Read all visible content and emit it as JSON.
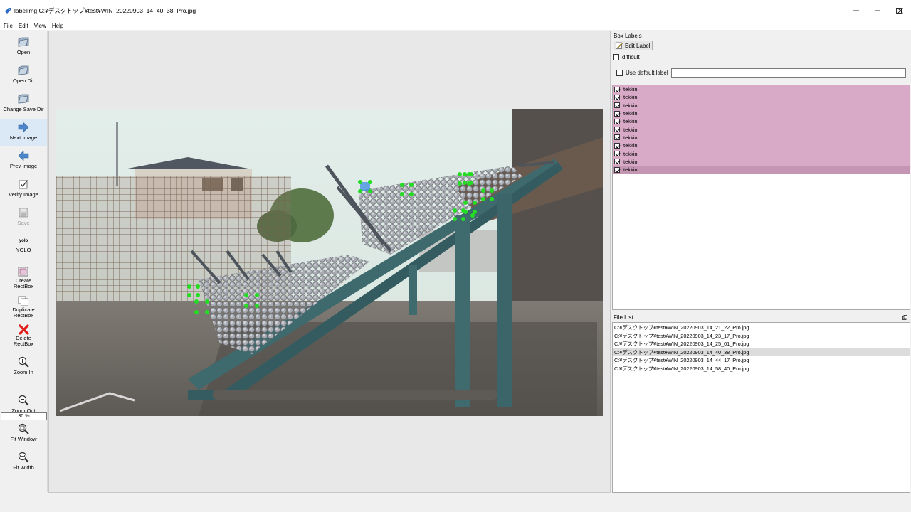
{
  "window": {
    "title": "labelImg C:¥デスクトップ¥test¥WIN_20220903_14_40_38_Pro.jpg"
  },
  "menu": [
    "File",
    "Edit",
    "View",
    "Help"
  ],
  "toolbar": {
    "open": "Open",
    "open_dir": "Open Dir",
    "change_save_dir": "Change Save Dir",
    "next_image": "Next Image",
    "prev_image": "Prev Image",
    "verify_image": "Verify Image",
    "save": "Save",
    "yolo_icon_text": "yolo",
    "yolo": "YOLO",
    "create_rectbox": "Create\nRectBox",
    "duplicate_rectbox": "Duplicate\nRectBox",
    "delete_rectbox": "Delete\nRectBox",
    "zoom_in": "Zoom In",
    "zoom_level": "30 %",
    "zoom_out": "Zoom Out",
    "fit_window": "Fit Window",
    "fit_width": "Fit Width"
  },
  "box_labels": {
    "title": "Box Labels",
    "edit_label": "Edit Label",
    "difficult": "difficult",
    "use_default_label": "Use default label",
    "default_label_value": "",
    "items": [
      {
        "label": "tekkin",
        "checked": true
      },
      {
        "label": "tekkin",
        "checked": true
      },
      {
        "label": "tekkin",
        "checked": true
      },
      {
        "label": "tekkin",
        "checked": true
      },
      {
        "label": "tekkin",
        "checked": true
      },
      {
        "label": "tekkin",
        "checked": true
      },
      {
        "label": "tekkin",
        "checked": true
      },
      {
        "label": "tekkin",
        "checked": true
      },
      {
        "label": "tekkin",
        "checked": true
      },
      {
        "label": "tekkin",
        "checked": true
      },
      {
        "label": "tekkin",
        "checked": true,
        "selected": true
      }
    ]
  },
  "file_list": {
    "title": "File List",
    "items": [
      {
        "path": "C:¥デスクトップ¥test¥WIN_20220903_14_21_22_Pro.jpg"
      },
      {
        "path": "C:¥デスクトップ¥test¥WIN_20220903_14_23_17_Pro.jpg"
      },
      {
        "path": "C:¥デスクトップ¥test¥WIN_20220903_14_25_01_Pro.jpg"
      },
      {
        "path": "C:¥デスクトップ¥test¥WIN_20220903_14_40_38_Pro.jpg",
        "selected": true
      },
      {
        "path": "C:¥デスクトップ¥test¥WIN_20220903_14_44_17_Pro.jpg"
      },
      {
        "path": "C:¥デスクトップ¥test¥WIN_20220903_14_58_40_Pro.jpg"
      }
    ]
  },
  "colors": {
    "label_row": "#d9aac8",
    "label_row_selected": "#c496b3",
    "vertex": "#22dd22",
    "selected_box": "#3b8de0"
  }
}
